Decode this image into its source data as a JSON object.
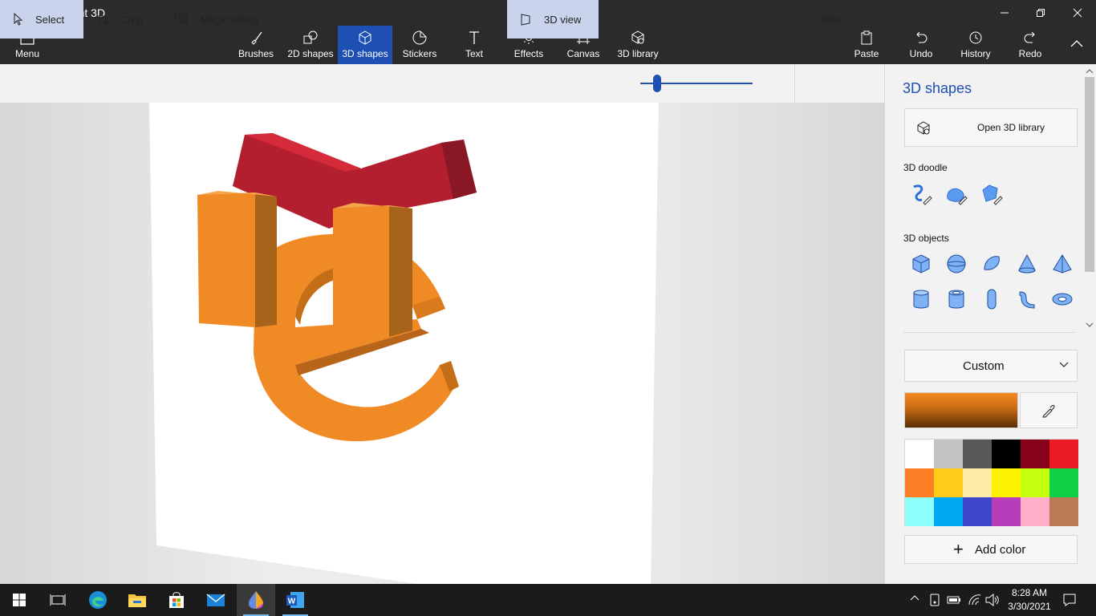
{
  "window": {
    "title": "Untitled* - Paint 3D"
  },
  "ribbon": {
    "menu_label": "Menu",
    "tabs": [
      {
        "label": "Brushes",
        "icon": "brush-icon"
      },
      {
        "label": "2D shapes",
        "icon": "2d-shapes-icon"
      },
      {
        "label": "3D shapes",
        "icon": "3d-shapes-icon",
        "active": true
      },
      {
        "label": "Stickers",
        "icon": "stickers-icon"
      },
      {
        "label": "Text",
        "icon": "text-icon"
      },
      {
        "label": "Effects",
        "icon": "effects-icon"
      },
      {
        "label": "Canvas",
        "icon": "canvas-icon"
      },
      {
        "label": "3D library",
        "icon": "3d-library-icon"
      }
    ],
    "paste_label": "Paste",
    "undo_label": "Undo",
    "history_label": "History",
    "redo_label": "Redo"
  },
  "toolbar": {
    "select_label": "Select",
    "crop_label": "Crop",
    "magic_select_label": "Magic select",
    "view_3d_label": "3D view",
    "zoom_value": "33%",
    "zoom_level": 0.33
  },
  "panel": {
    "title": "3D shapes",
    "open_library_label": "Open 3D library",
    "doodle_label": "3D doodle",
    "doodles": [
      "sharp-edge-doodle-icon",
      "soft-edge-doodle-icon",
      "tube-doodle-icon"
    ],
    "objects_label": "3D objects",
    "objects": [
      "cube-icon",
      "sphere-icon",
      "hemisphere-icon",
      "cone-icon",
      "pyramid-icon",
      "cylinder-icon",
      "tube-icon",
      "capsule-icon",
      "bent-tube-icon",
      "donut-icon"
    ],
    "color_mode": "Custom",
    "current_color": "#f08a24",
    "palette": [
      "#ffffff",
      "#c3c3c3",
      "#585858",
      "#000000",
      "#88001b",
      "#ec1c24",
      "#ff7f27",
      "#ffca18",
      "#fdeca6",
      "#fff200",
      "#c4ff0e",
      "#0ed145",
      "#8cfffb",
      "#00a8f3",
      "#3f48cc",
      "#b83dba",
      "#ffaec8",
      "#b97a56"
    ],
    "add_color_label": "Add color"
  },
  "taskbar": {
    "time": "8:28 AM",
    "date": "3/30/2021",
    "apps": [
      "start-icon",
      "task-view-icon",
      "edge-icon",
      "file-explorer-icon",
      "store-icon",
      "mail-icon",
      "paint-3d-icon",
      "word-icon"
    ]
  },
  "colors": {
    "accent": "#1e4fb3",
    "ribbon_bg": "#2b2b2b",
    "letter_orange": "#f08a24",
    "bar_red": "#b01e2c"
  }
}
